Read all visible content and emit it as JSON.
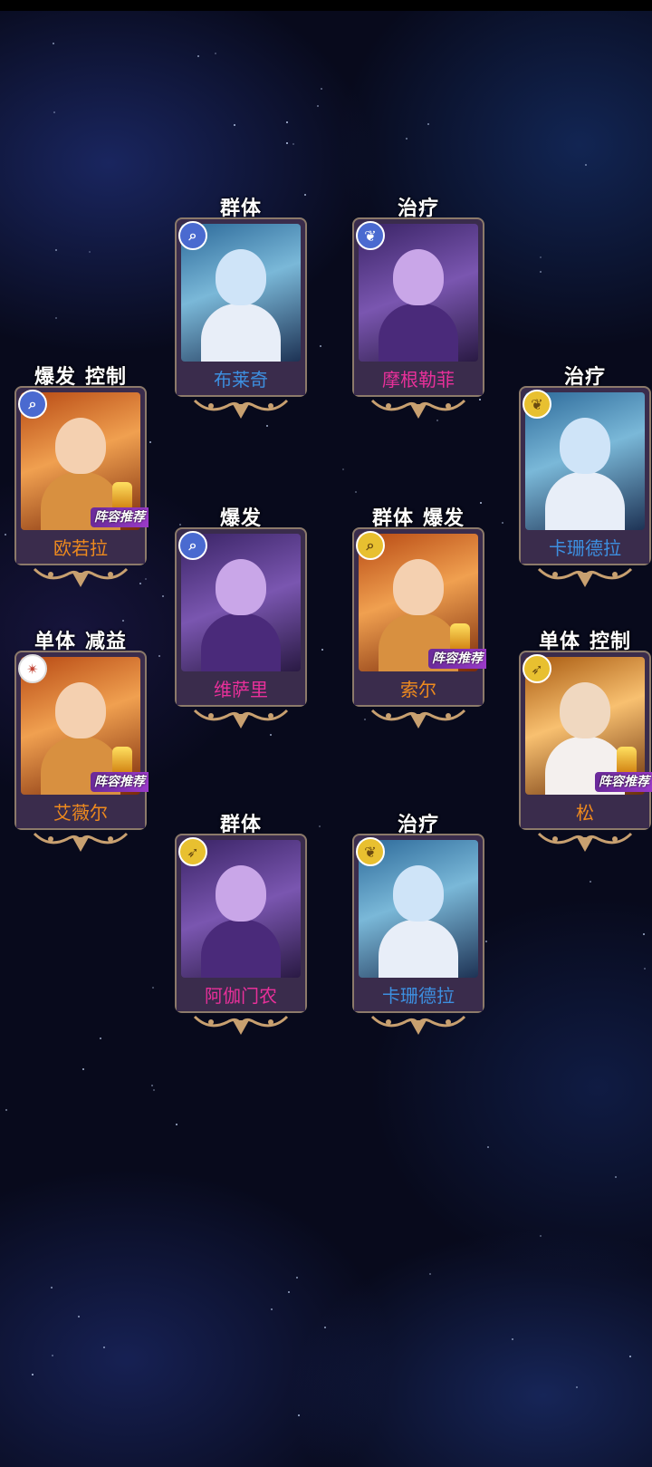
{
  "colors": {
    "name_blue": "#3d8fe0",
    "name_pink": "#e8309a",
    "name_orange": "#ee8a1e",
    "frame_bg": "#3a2c4c",
    "ornament_gold": "#c8a070"
  },
  "cards": [
    {
      "id": "blake",
      "tags": [
        "群体"
      ],
      "name": "布莱奇",
      "name_color": "#3d8fe0",
      "class_icon": "magnifier-icon",
      "icon_style": "blue",
      "theme": "blue",
      "recommended": false
    },
    {
      "id": "morgan",
      "tags": [
        "治疗"
      ],
      "name": "摩根勒菲",
      "name_color": "#e8309a",
      "class_icon": "angel-wing-icon",
      "icon_style": "blue",
      "theme": "purple",
      "recommended": false
    },
    {
      "id": "orla",
      "tags": [
        "爆发",
        "控制"
      ],
      "name": "欧若拉",
      "name_color": "#ee8a1e",
      "class_icon": "magnifier-icon",
      "icon_style": "blue",
      "theme": "orange",
      "recommended": true
    },
    {
      "id": "kashan1",
      "tags": [
        "治疗"
      ],
      "name": "卡珊德拉",
      "name_color": "#3d8fe0",
      "class_icon": "angel-wing-icon",
      "icon_style": "yellow",
      "theme": "blue",
      "recommended": false
    },
    {
      "id": "visari",
      "tags": [
        "爆发"
      ],
      "name": "维萨里",
      "name_color": "#e8309a",
      "class_icon": "magnifier-icon",
      "icon_style": "blue",
      "theme": "purple",
      "recommended": false
    },
    {
      "id": "sol",
      "tags": [
        "群体",
        "爆发"
      ],
      "name": "索尔",
      "name_color": "#ee8a1e",
      "class_icon": "magnifier-icon",
      "icon_style": "yellow",
      "theme": "orange",
      "recommended": true
    },
    {
      "id": "aiweier",
      "tags": [
        "单体",
        "减益"
      ],
      "name": "艾薇尔",
      "name_color": "#ee8a1e",
      "class_icon": "shuriken-icon",
      "icon_style": "red",
      "theme": "orange",
      "recommended": true
    },
    {
      "id": "song",
      "tags": [
        "单体",
        "控制"
      ],
      "name": "松",
      "name_color": "#ee8a1e",
      "class_icon": "bow-icon",
      "icon_style": "yellow",
      "theme": "golden",
      "recommended": true
    },
    {
      "id": "agamemnon",
      "tags": [
        "群体"
      ],
      "name": "阿伽门农",
      "name_color": "#e8309a",
      "class_icon": "bow-icon",
      "icon_style": "yellow",
      "theme": "purple",
      "recommended": false
    },
    {
      "id": "kashan2",
      "tags": [
        "治疗"
      ],
      "name": "卡珊德拉",
      "name_color": "#3d8fe0",
      "class_icon": "angel-wing-icon",
      "icon_style": "yellow",
      "theme": "blue",
      "recommended": false
    }
  ],
  "recommend_label": "阵容推荐"
}
